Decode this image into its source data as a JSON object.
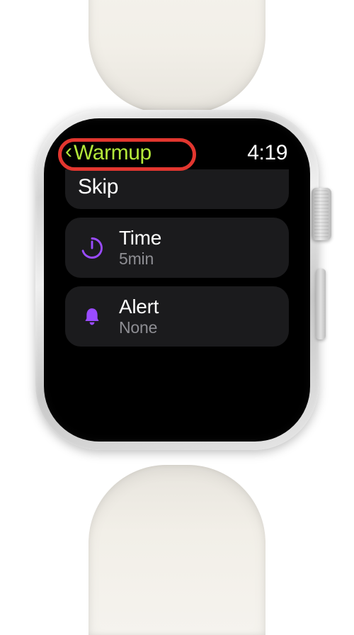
{
  "header": {
    "back_label": "Warmup",
    "time": "4:19"
  },
  "rows": {
    "skip": {
      "label": "Skip"
    },
    "time": {
      "label": "Time",
      "value": "5min"
    },
    "alert": {
      "label": "Alert",
      "value": "None"
    }
  },
  "colors": {
    "accent_green": "#b4e83a",
    "icon_purple": "#9a4bff",
    "highlight_red": "#e2362f"
  }
}
